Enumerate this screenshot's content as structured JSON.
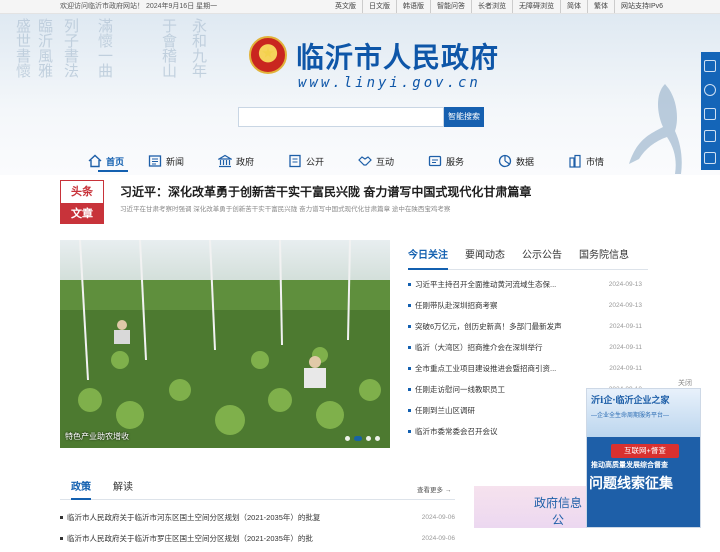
{
  "topbar": {
    "welcome": "欢迎访问临沂市政府网站！ 2024年9月16日 星期一",
    "links": [
      "英文版",
      "日文版",
      "韩语版",
      "智能问答",
      "长者浏览",
      "无障碍浏览",
      "简体",
      "繁体",
      "网站支持IPv6"
    ]
  },
  "header": {
    "site_name": "临沂市人民政府",
    "site_url": "www.linyi.gov.cn",
    "search_placeholder": "",
    "search_button": "智能搜索"
  },
  "nav": [
    {
      "label": "首页",
      "icon": "home-icon",
      "active": true
    },
    {
      "label": "新闻",
      "icon": "news-icon"
    },
    {
      "label": "政府",
      "icon": "government-icon"
    },
    {
      "label": "公开",
      "icon": "disclosure-icon"
    },
    {
      "label": "互动",
      "icon": "handshake-icon"
    },
    {
      "label": "服务",
      "icon": "service-icon"
    },
    {
      "label": "数据",
      "icon": "data-icon"
    },
    {
      "label": "市情",
      "icon": "city-icon"
    }
  ],
  "headline": {
    "badge_top": "头条",
    "badge_bottom": "文章",
    "title": "习近平：深化改革勇于创新苦干实干富民兴陇 奋力谱写中国式现代化甘肃篇章",
    "summary": "习近平在甘肃考察时强调 深化改革勇于创新苦干实干富民兴陇 奋力谱写中国式现代化甘肃篇章 途中在陕西宝鸡考察"
  },
  "carousel": {
    "caption": "特色产业助农增收",
    "slide_count": 4,
    "active_slide": 1
  },
  "news_tabs": [
    "今日关注",
    "要闻动态",
    "公示公告",
    "国务院信息"
  ],
  "news_items": [
    {
      "title": "习近平主持召开全面推动黄河流域生态保...",
      "date": "2024-09-13"
    },
    {
      "title": "任刚带队赴深圳招商考察",
      "date": "2024-09-13"
    },
    {
      "title": "突破6万亿元，创历史新高！多部门最新发声",
      "date": "2024-09-11"
    },
    {
      "title": "临沂（大湾区）招商推介会在深圳举行",
      "date": "2024-09-11"
    },
    {
      "title": "全市重点工业项目建设推进会暨招商引资...",
      "date": "2024-09-11"
    },
    {
      "title": "任刚走访慰问一线教职员工",
      "date": "2024-09-10"
    },
    {
      "title": "任刚到兰山区调研",
      "date": "2024-09-10"
    },
    {
      "title": "临沂市委常委会召开会议",
      "date": "2024-09-10"
    }
  ],
  "policy_tabs": [
    "政策",
    "解读"
  ],
  "policy_more": "查看更多",
  "policy_items": [
    {
      "title": "临沂市人民政府关于临沂市河东区国土空间分区规划（2021-2035年）的批复",
      "date": "2024-09-06"
    },
    {
      "title": "临沂市人民政府关于临沂市罗庄区国土空间分区规划（2021-2035年）的批",
      "date": "2024-09-06"
    }
  ],
  "info_box": {
    "label": "政府信息公"
  },
  "float_ad": {
    "close": "关闭",
    "title": "沂i企·临沂企业之家",
    "subtitle": "—企业全生命周期服务平台—",
    "pill": "互联网+督查",
    "line2": "推动高质量发展综合督查",
    "line3": "问题线索征集"
  },
  "side_icons": [
    "email-icon",
    "user-icon",
    "wechat-icon",
    "app-icon",
    "weibo-icon"
  ],
  "colors": {
    "brand": "#1360b0",
    "accent_red": "#c8333a"
  }
}
